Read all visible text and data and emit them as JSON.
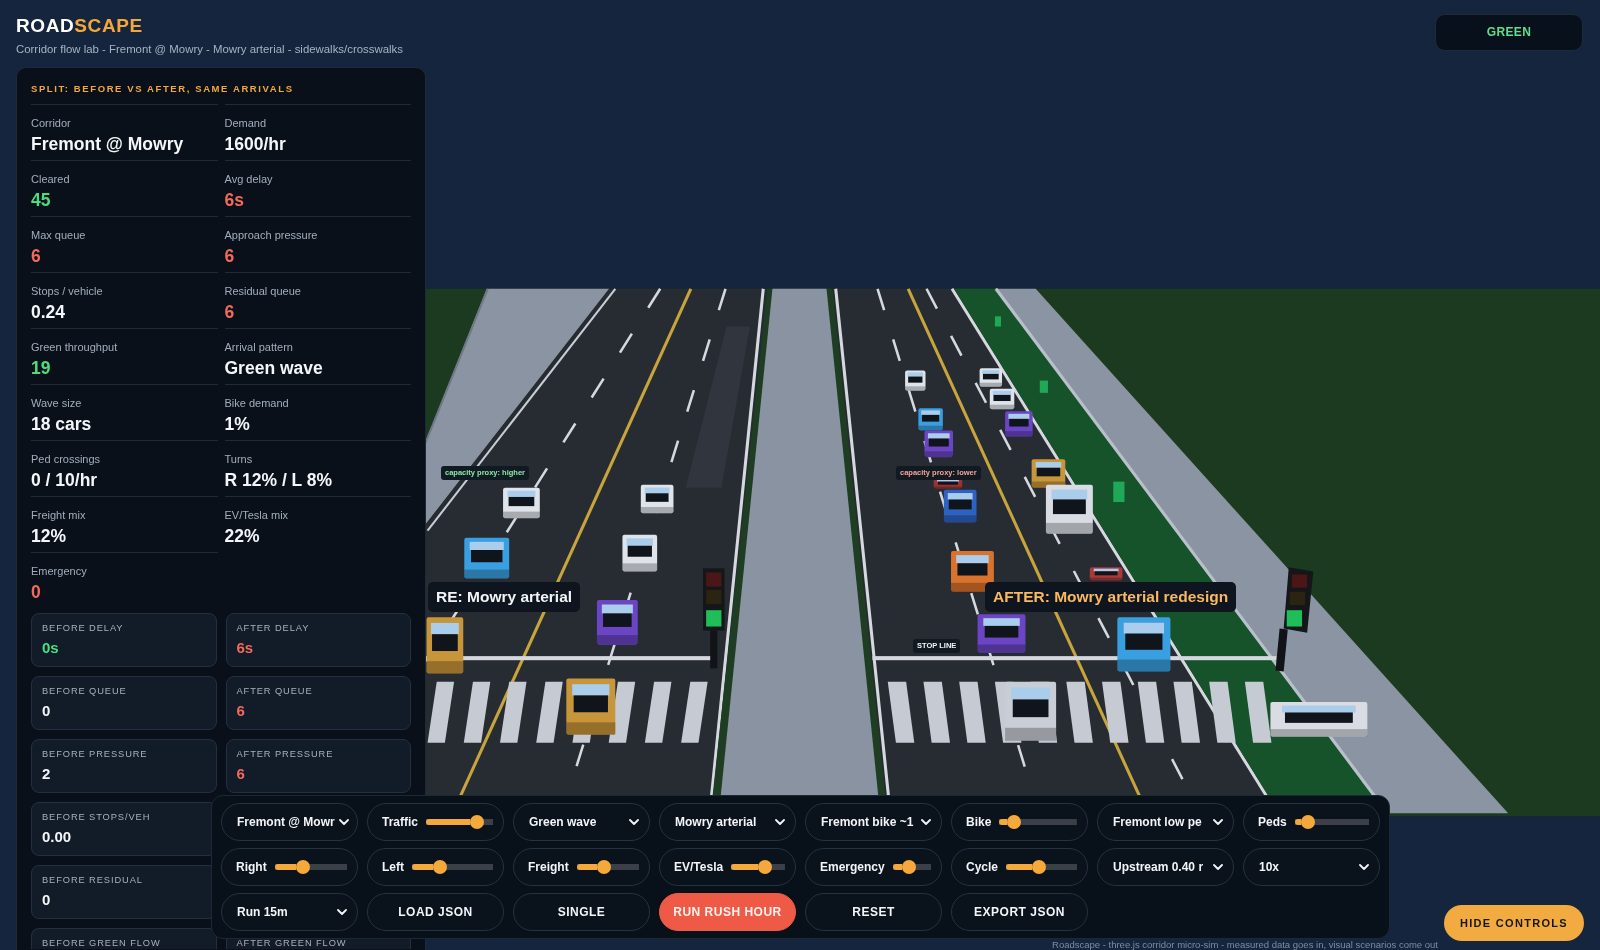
{
  "header": {
    "brand": {
      "lead": "ROAD",
      "accent": "SCAPE"
    },
    "subtitle": "Corridor flow lab - Fremont @ Mowry - Mowry arterial - sidewalks/crosswalks"
  },
  "signal_status": "GREEN",
  "panel": {
    "title": "SPLIT: BEFORE VS AFTER, SAME ARRIVALS",
    "stats": [
      {
        "label": "Corridor",
        "value": "Fremont @ Mowry",
        "color": "#f4f6f9"
      },
      {
        "label": "Demand",
        "value": "1600/hr",
        "color": "#f4f6f9"
      },
      {
        "label": "Cleared",
        "value": "45",
        "color": "#4ade80"
      },
      {
        "label": "Avg delay",
        "value": "6s",
        "color": "#f26a5a"
      },
      {
        "label": "Max queue",
        "value": "6",
        "color": "#f26a5a"
      },
      {
        "label": "Approach pressure",
        "value": "6",
        "color": "#f26a5a"
      },
      {
        "label": "Stops / vehicle",
        "value": "0.24",
        "color": "#f4f6f9"
      },
      {
        "label": "Residual queue",
        "value": "6",
        "color": "#f26a5a"
      },
      {
        "label": "Green throughput",
        "value": "19",
        "color": "#4ade80"
      },
      {
        "label": "Arrival pattern",
        "value": "Green wave",
        "color": "#f4f6f9"
      },
      {
        "label": "Wave size",
        "value": "18 cars",
        "color": "#f4f6f9"
      },
      {
        "label": "Bike demand",
        "value": "1%",
        "color": "#f4f6f9"
      },
      {
        "label": "Ped crossings",
        "value": "0 / 10/hr",
        "color": "#f4f6f9"
      },
      {
        "label": "Turns",
        "value": "R 12% / L 8%",
        "color": "#f4f6f9"
      },
      {
        "label": "Freight mix",
        "value": "12%",
        "color": "#f4f6f9"
      },
      {
        "label": "EV/Tesla mix",
        "value": "22%",
        "color": "#f4f6f9"
      },
      {
        "label": "Emergency",
        "value": "0",
        "color": "#f26a5a"
      }
    ],
    "comparisons": [
      {
        "before": {
          "label": "BEFORE DELAY",
          "value": "0s",
          "color": "#4ade80"
        },
        "after": {
          "label": "AFTER DELAY",
          "value": "6s",
          "color": "#f26a5a"
        }
      },
      {
        "before": {
          "label": "BEFORE QUEUE",
          "value": "0",
          "color": "#f4f6f9"
        },
        "after": {
          "label": "AFTER QUEUE",
          "value": "6",
          "color": "#f26a5a"
        }
      },
      {
        "before": {
          "label": "BEFORE PRESSURE",
          "value": "2",
          "color": "#f4f6f9"
        },
        "after": {
          "label": "AFTER PRESSURE",
          "value": "6",
          "color": "#f26a5a"
        }
      },
      {
        "before": {
          "label": "BEFORE STOPS/VEH",
          "value": "0.00",
          "color": "#f4f6f9"
        }
      },
      {
        "before": {
          "label": "BEFORE RESIDUAL",
          "value": "0",
          "color": "#f4f6f9"
        }
      },
      {
        "before": {
          "label": "BEFORE GREEN FLOW"
        },
        "after": {
          "label": "AFTER GREEN FLOW"
        }
      }
    ]
  },
  "scene": {
    "labels": [
      {
        "kind": "tag",
        "text": "capacity proxy: higher",
        "color": "#8fe6a8"
      },
      {
        "kind": "tag",
        "text": "capacity proxy: lower",
        "color": "#f4a496"
      },
      {
        "kind": "banner",
        "text": "RE: Mowry arterial",
        "color": "#f2f4f7"
      },
      {
        "kind": "banner",
        "text": "AFTER: Mowry arterial redesign",
        "color": "#f9b862"
      },
      {
        "kind": "tag",
        "text": "STOP LINE",
        "color": "#f2f4f7"
      }
    ]
  },
  "controls": {
    "rows": [
      [
        {
          "kind": "select",
          "text": "Fremont @ Mowr"
        },
        {
          "kind": "slider",
          "label": "Traffic",
          "level": 0.66
        },
        {
          "kind": "select",
          "text": "Green wave"
        },
        {
          "kind": "select",
          "text": "Mowry arterial"
        },
        {
          "kind": "select",
          "text": "Fremont bike ~1"
        },
        {
          "kind": "slider",
          "label": "Bike",
          "level": 0.1
        },
        {
          "kind": "select",
          "text": "Fremont low pe"
        },
        {
          "kind": "slider",
          "label": "Peds",
          "level": 0.08
        }
      ],
      [
        {
          "kind": "slider",
          "label": "Right",
          "level": 0.3
        },
        {
          "kind": "slider",
          "label": "Left",
          "level": 0.26
        },
        {
          "kind": "slider",
          "label": "Freight",
          "level": 0.33
        },
        {
          "kind": "slider",
          "label": "EV/Tesla",
          "level": 0.5
        },
        {
          "kind": "slider",
          "label": "Emergency",
          "level": 0.25
        },
        {
          "kind": "slider",
          "label": "Cycle",
          "level": 0.37
        },
        {
          "kind": "select",
          "text": "Upstream 0.40 r"
        },
        {
          "kind": "select",
          "text": "10x"
        }
      ],
      [
        {
          "kind": "select",
          "text": "Run 15m"
        },
        {
          "kind": "button",
          "text": "LOAD JSON"
        },
        {
          "kind": "button",
          "text": "SINGLE"
        },
        {
          "kind": "primary",
          "text": "RUN RUSH HOUR"
        },
        {
          "kind": "button",
          "text": "RESET"
        },
        {
          "kind": "button",
          "text": "EXPORT JSON"
        }
      ]
    ]
  },
  "hide_button": "HIDE CONTROLS",
  "footer": "Roadscape - three.js corridor micro-sim - measured data goes in, visual scenarios come out"
}
